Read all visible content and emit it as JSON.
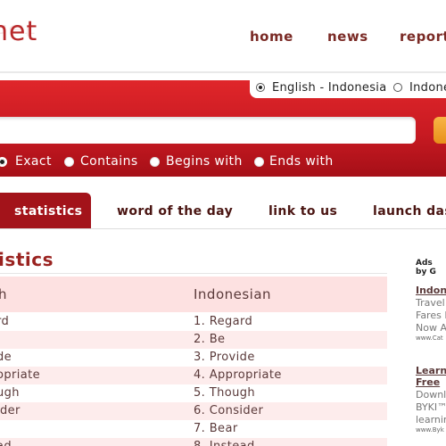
{
  "header": {
    "logo_text": "net",
    "nav": [
      "home",
      "news",
      "report"
    ]
  },
  "search": {
    "languages": [
      {
        "label": "English - Indonesia",
        "selected": true
      },
      {
        "label": "Indone",
        "selected": false
      }
    ],
    "value": "",
    "match_options": [
      {
        "label": "Exact",
        "selected": true
      },
      {
        "label": "Contains",
        "selected": false
      },
      {
        "label": "Begins with",
        "selected": false
      },
      {
        "label": "Ends with",
        "selected": false
      }
    ]
  },
  "tabs": [
    {
      "label": "statistics",
      "active": true
    },
    {
      "label": "word of the day",
      "active": false
    },
    {
      "label": "link to us",
      "active": false
    },
    {
      "label": "launch das",
      "active": false
    }
  ],
  "main": {
    "title": "tistics",
    "columns": [
      "h",
      "Indonesian"
    ],
    "rows": [
      {
        "en": "rd",
        "id": "1. Regard"
      },
      {
        "en": "",
        "id": "2. Be"
      },
      {
        "en": "de",
        "id": "3. Provide"
      },
      {
        "en": "opriate",
        "id": "4. Appropriate"
      },
      {
        "en": "ugh",
        "id": "5. Though"
      },
      {
        "en": "ider",
        "id": "6. Consider"
      },
      {
        "en": "",
        "id": "7. Bear"
      },
      {
        "en": "ad",
        "id": "8. Instead"
      }
    ]
  },
  "ads": {
    "label": "Ads by G",
    "items": [
      {
        "title": "Indone",
        "lines": [
          "Travel I",
          "Fares E",
          "Now Av"
        ],
        "url": "www.Cat"
      },
      {
        "title_lines": [
          "Learn",
          "Free"
        ],
        "lines": [
          "Downlo",
          "BYKI™",
          "learnin"
        ],
        "url": "www.Byk"
      }
    ]
  },
  "colors": {
    "brand_red": "#c81a22",
    "accent_orange": "#f0a030",
    "row_pink": "#fdecec"
  }
}
